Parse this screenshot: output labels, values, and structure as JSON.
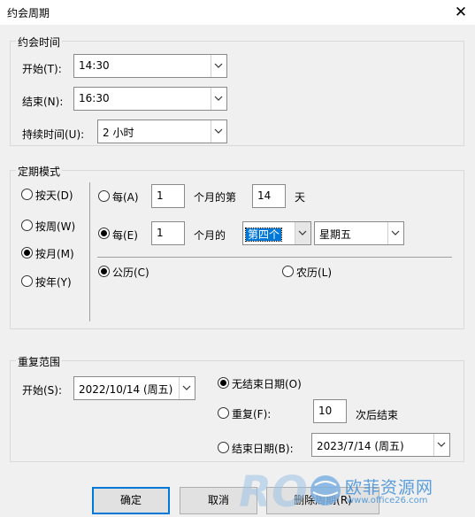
{
  "dialog": {
    "title": "约会周期"
  },
  "appointment_time": {
    "legend": "约会时间",
    "start": {
      "label": "开始(T):",
      "value": "14:30"
    },
    "end": {
      "label": "结束(N):",
      "value": "16:30"
    },
    "duration": {
      "label": "持续时间(U):",
      "value": "2 小时"
    }
  },
  "pattern": {
    "legend": "定期模式",
    "types": [
      "按天(D)",
      "按周(W)",
      "按月(M)",
      "按年(Y)"
    ],
    "selected_type": "按月(M)",
    "option_a": {
      "label": "每(A)",
      "months": "1",
      "mid": "个月的第",
      "day": "14",
      "unit": "天"
    },
    "option_e": {
      "label": "每(E)",
      "months": "1",
      "mid": "个月的",
      "ordinal": "第四个",
      "weekday": "星期五"
    },
    "calendar": {
      "gregorian": "公历(C)",
      "lunar": "农历(L)"
    }
  },
  "range": {
    "legend": "重复范围",
    "start": {
      "label": "开始(S):",
      "value": "2022/10/14 (周五)"
    },
    "no_end": "无结束日期(O)",
    "repeat": {
      "label": "重复(F):",
      "value": "10",
      "suffix": "次后结束"
    },
    "end_by": {
      "label": "结束日期(B):",
      "value": "2023/7/14 (周五)"
    }
  },
  "buttons": {
    "ok": "确定",
    "cancel": "取消",
    "remove": "删除周期(R)"
  },
  "watermark": {
    "brand": "欧菲资源网",
    "url": "www.office26.com"
  },
  "colors": {
    "accent": "#0078d7",
    "background": "#f0f0f0"
  }
}
